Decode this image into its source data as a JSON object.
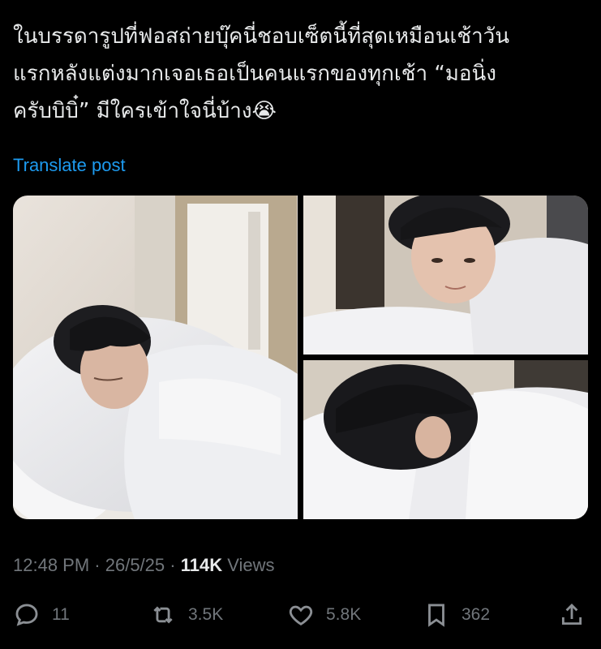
{
  "post": {
    "text_lines": [
      "ในบรรดารูปที่ฟอสถ่ายบุ๊คนี่ชอบเซ็ตนี้ที่สุดเหมือนเช้าวัน",
      "แรกหลังแต่งมากเจอเธอเป็นคนแรกของทุกเช้า “มอนิ่ง",
      "ครับบิบิ๋” มีใครเข้าใจนี่บ้าง😭"
    ],
    "translate_label": "Translate post"
  },
  "media": {
    "photos": [
      {
        "alt": "photo-1",
        "icon": "photo-person-lying-in-bed"
      },
      {
        "alt": "photo-2",
        "icon": "photo-person-leaning-on-bed"
      },
      {
        "alt": "photo-3",
        "icon": "photo-person-face-in-pillow"
      }
    ]
  },
  "meta": {
    "time": "12:48 PM",
    "separator": " · ",
    "date": "26/5/25",
    "views_count": "114K",
    "views_label": " Views"
  },
  "actions": {
    "reply_count": "11",
    "repost_count": "3.5K",
    "like_count": "5.8K",
    "bookmark_count": "362"
  },
  "colors": {
    "background": "#000000",
    "text": "#e7e9ea",
    "muted": "#71767b",
    "link": "#1d9bf0"
  }
}
